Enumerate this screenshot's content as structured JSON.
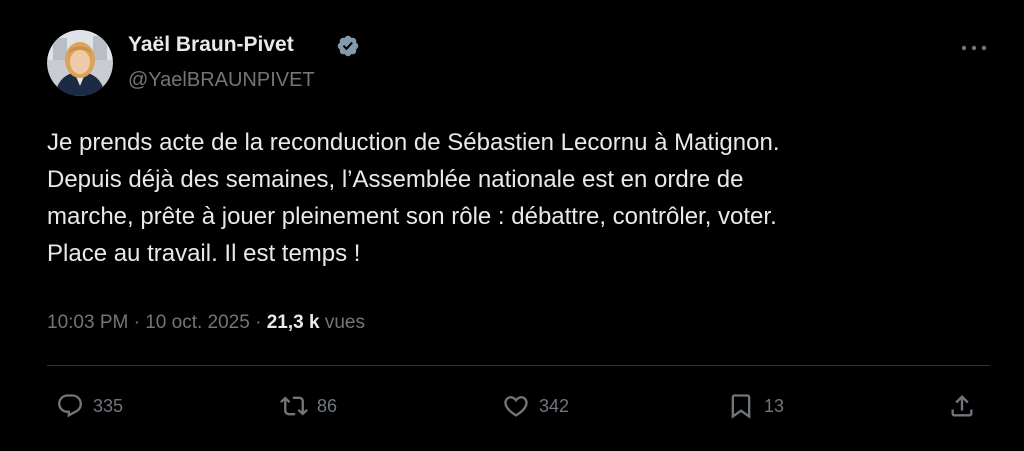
{
  "author": {
    "display_name": "Yaël Braun-Pivet",
    "handle": "@YaelBRAUNPIVET",
    "verified_icon": "verified-badge-icon",
    "avatar_icon": "profile-photo"
  },
  "tweet": {
    "text_lines": [
      "Je prends acte de la reconduction de Sébastien Lecornu à Matignon.",
      "Depuis déjà des semaines, l’Assemblée nationale est en ordre de",
      "marche, prête à jouer pleinement son rôle : débattre, contrôler, voter.",
      "Place au travail. Il est temps !"
    ],
    "time": "10:03 PM",
    "separator": "·",
    "date": "10 oct. 2025",
    "views_count": "21,3 k",
    "views_label": "vues"
  },
  "actions": {
    "reply_count": "335",
    "repost_count": "86",
    "like_count": "342",
    "bookmark_count": "13"
  },
  "colors": {
    "background": "#000000",
    "primary_text": "#e7e9ea",
    "secondary_text": "#71767b",
    "divider": "#2f3336",
    "verified": "#829aab"
  }
}
